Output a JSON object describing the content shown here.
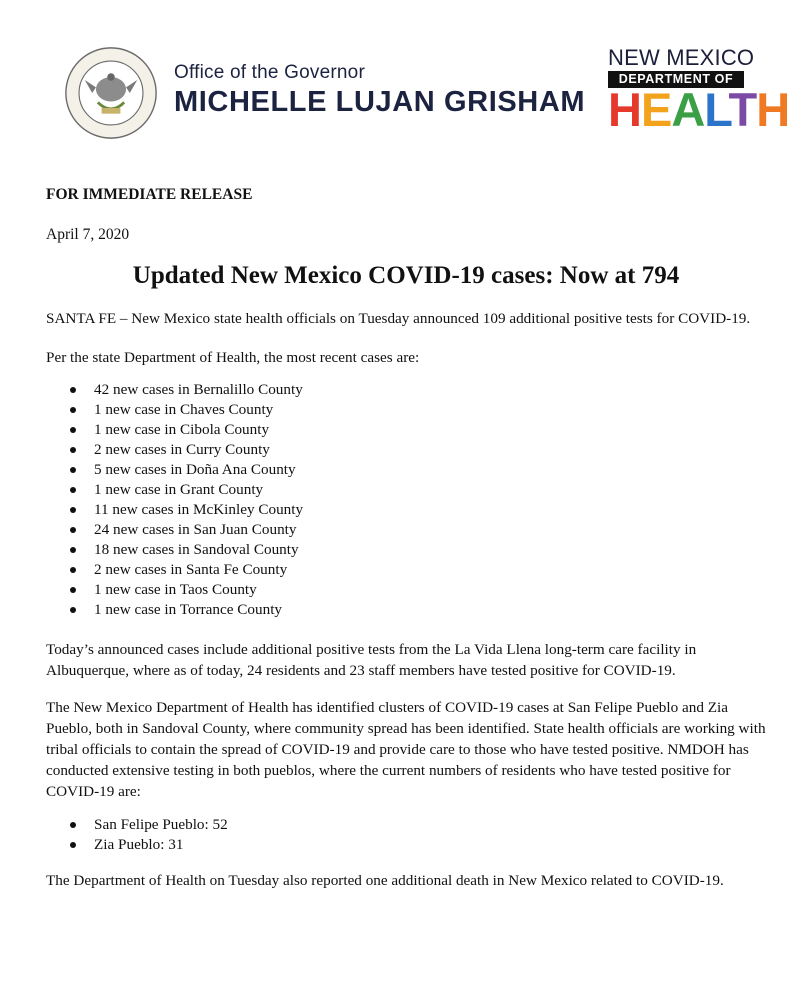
{
  "header": {
    "seal_text": "GREAT SEAL OF THE STATE OF NEW MEXICO 1912",
    "office_line": "Office of the Governor",
    "governor_name": "MICHELLE LUJAN GRISHAM",
    "doh_top": "NEW MEXICO",
    "doh_middle": "DEPARTMENT OF",
    "doh_letters": [
      {
        "ch": "H",
        "color": "#e53a2b"
      },
      {
        "ch": "E",
        "color": "#f3a21b"
      },
      {
        "ch": "A",
        "color": "#3a9f45"
      },
      {
        "ch": "L",
        "color": "#2b74c9"
      },
      {
        "ch": "T",
        "color": "#7b4aa5"
      },
      {
        "ch": "H",
        "color": "#ef7a23"
      }
    ]
  },
  "release": {
    "label": "FOR IMMEDIATE RELEASE",
    "date": "April 7, 2020",
    "title": "Updated New Mexico COVID-19 cases: Now at 794",
    "para1": "SANTA FE – New Mexico state health officials on Tuesday announced 109 additional positive tests for COVID-19.",
    "para2": "Per the state Department of Health, the most recent cases are:",
    "county_cases": [
      "42 new cases in Bernalillo County",
      "1 new case in Chaves County",
      "1 new case in Cibola County",
      "2 new cases in Curry County",
      "5 new cases in Doña Ana County",
      "1 new case in Grant County",
      "11 new cases in McKinley County",
      "24 new cases in San Juan County",
      "18 new cases in Sandoval County",
      "2 new cases in Santa Fe County",
      "1 new case in Taos County",
      "1 new case in Torrance County"
    ],
    "para3": "Today’s announced cases include additional positive tests from the La Vida Llena long-term care facility in Albuquerque, where as of today, 24 residents and 23 staff members have tested positive for COVID-19.",
    "para4": "The New Mexico Department of Health has identified clusters of COVID-19 cases at San Felipe Pueblo and Zia Pueblo, both in Sandoval County, where community spread has been identified. State health officials are working with tribal officials to contain the spread of COVID-19 and provide care to those who have tested positive. NMDOH has conducted extensive testing in both pueblos, where the current numbers of residents who have tested positive for COVID-19 are:",
    "pueblo_cases": [
      "San Felipe Pueblo: 52",
      "Zia Pueblo: 31"
    ],
    "para5": "The Department of Health on Tuesday also reported one additional death in New Mexico related to COVID-19."
  }
}
